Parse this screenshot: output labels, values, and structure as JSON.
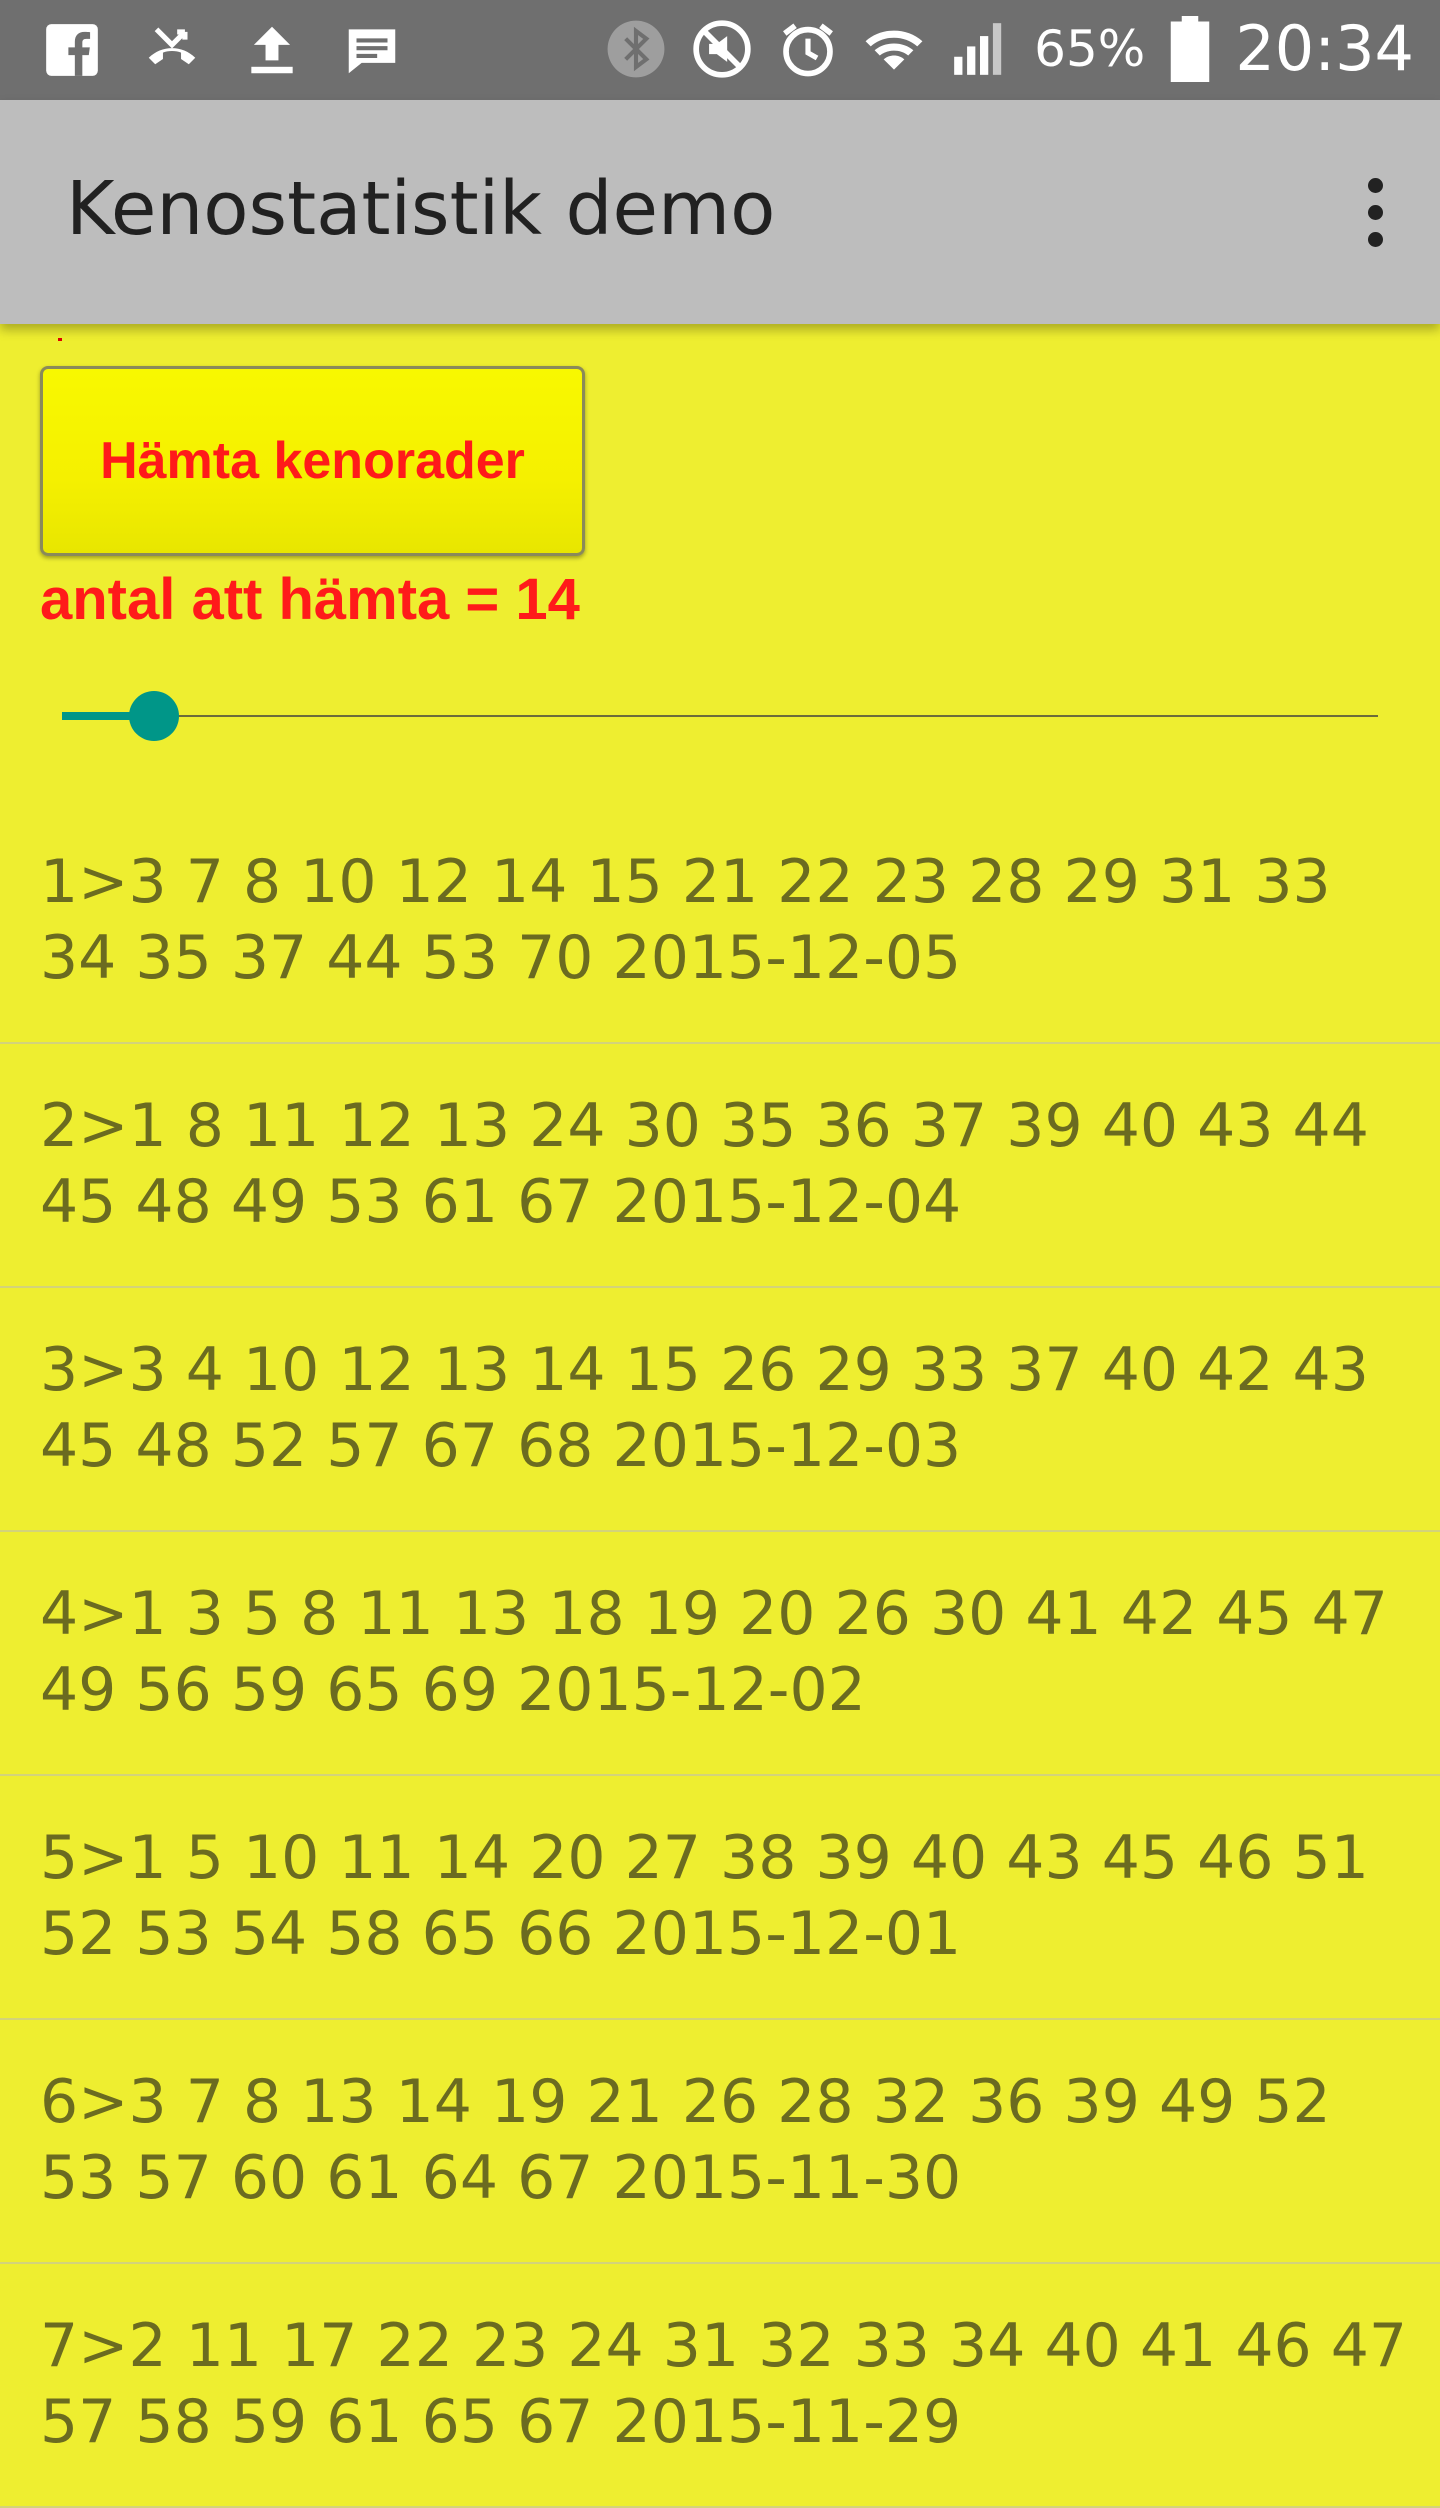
{
  "status_bar": {
    "left_icons": [
      "facebook-icon",
      "missed-call-icon",
      "upload-icon",
      "message-icon"
    ],
    "right_icons": [
      "bluetooth-icon",
      "mute-icon",
      "alarm-icon",
      "wifi-icon",
      "signal-icon"
    ],
    "battery_percent": "65%",
    "time": "20:34"
  },
  "app_bar": {
    "title": "Kenostatistik demo",
    "menu_icon": "overflow-menu-icon"
  },
  "controls": {
    "fetch_button_label": "Hämta kenorader",
    "count_label": "antal att hämta = 14",
    "slider_value_fraction": 0.07
  },
  "draws": [
    {
      "text": "1>3 7 8 10 12 14 15 21 22 23 28 29 31 33 34 35 37 44 53 70   2015-12-05"
    },
    {
      "text": "2>1 8 11 12 13 24 30 35 36 37 39 40 43 44 45 48 49 53 61 67   2015-12-04"
    },
    {
      "text": "3>3 4 10 12 13 14 15 26 29 33 37 40 42 43 45 48 52 57 67 68   2015-12-03"
    },
    {
      "text": "4>1 3 5 8 11 13 18 19 20 26 30 41 42 45 47 49 56 59 65 69   2015-12-02"
    },
    {
      "text": "5>1 5 10 11 14 20 27 38 39 40 43 45 46 51 52 53 54 58 65 66   2015-12-01"
    },
    {
      "text": "6>3 7 8 13 14 19 21 26 28 32 36 39 49 52 53 57 60 61 64 67   2015-11-30"
    },
    {
      "text": "7>2 11 17 22 23 24 31 32 33 34 40 41 46 47 57 58 59 61 65 67   2015-11-29"
    }
  ],
  "colors": {
    "background": "#eeee30",
    "accent": "#009688",
    "label_red": "#ff1a1a",
    "row_text": "#6b6b20"
  }
}
